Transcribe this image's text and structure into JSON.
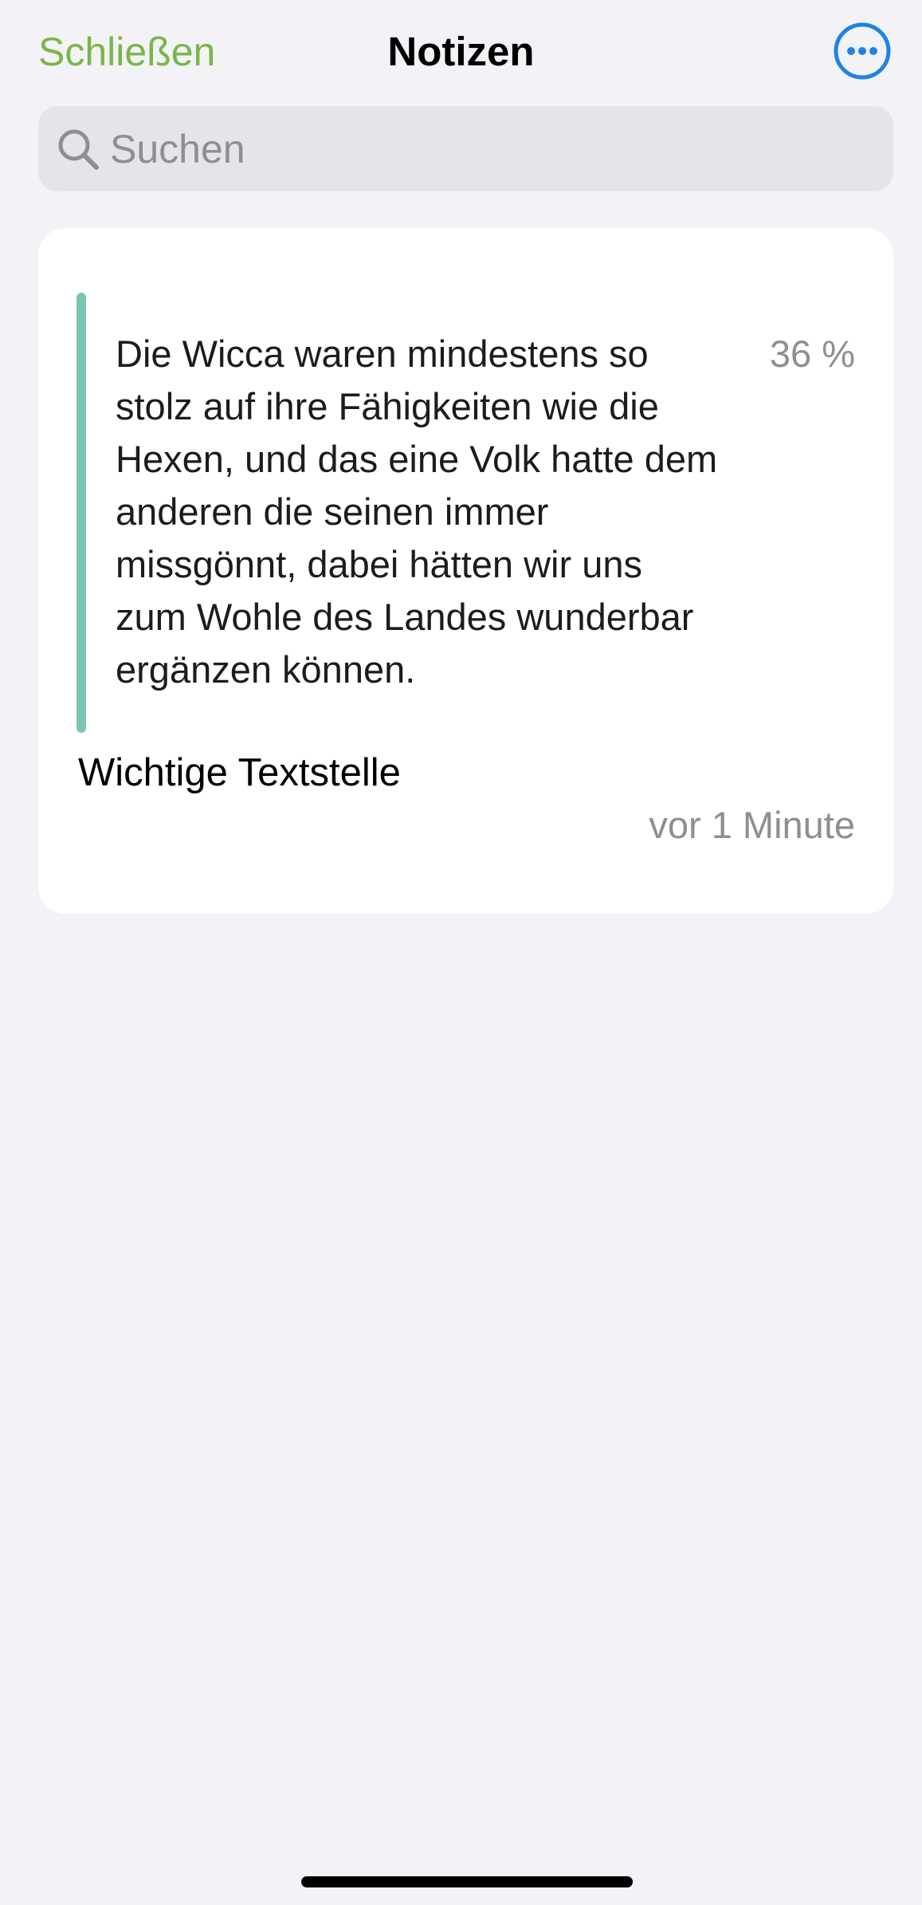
{
  "header": {
    "close_label": "Schließen",
    "title": "Notizen",
    "more_icon": "ellipsis-circle-icon"
  },
  "search": {
    "placeholder": "Suchen",
    "value": "",
    "icon": "search-icon"
  },
  "notes": [
    {
      "quote": "Die Wicca waren mindestens so stolz auf ihre Fähigkeiten wie die Hexen, und das eine Volk hatte dem anderen die seinen immer missgönnt, dabei hätten wir uns zum Wohle des Landes wunderbar ergänzen können.",
      "progress": "36 %",
      "note": "Wichtige Textstelle",
      "timestamp": "vor 1 Minute"
    }
  ],
  "colors": {
    "accent_green": "#7ab648",
    "accent_blue": "#1e82e6",
    "highlight": "#7cc4b4",
    "background": "#f2f2f7",
    "card": "#ffffff",
    "secondary_text": "#8e8e93"
  }
}
